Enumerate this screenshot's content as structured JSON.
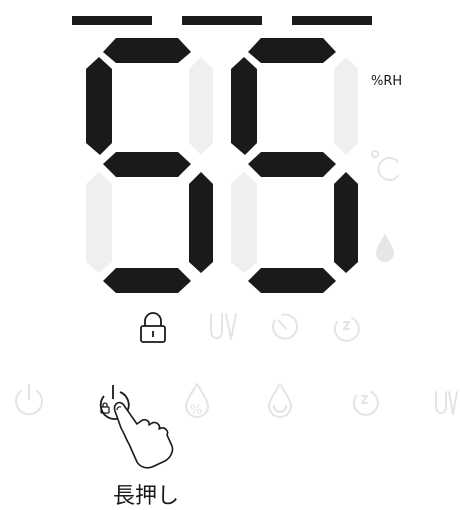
{
  "display": {
    "value": "55",
    "unit": "%RH",
    "mode_bars": 3
  },
  "icons": {
    "lock": "lock-icon",
    "celsius": "celsius-icon",
    "drop": "water-drop-icon",
    "uv": "uv-icon",
    "timer": "timer-icon",
    "sleep": "sleep-mode-icon",
    "power": "power-icon",
    "humidity": "humidity-icon",
    "water": "water-level-icon"
  },
  "hint": {
    "press_label": "長押し"
  },
  "colors": {
    "segment_on": "#1a1a1a",
    "segment_off": "#efefef",
    "dim_icon": "#e4e4e4"
  }
}
